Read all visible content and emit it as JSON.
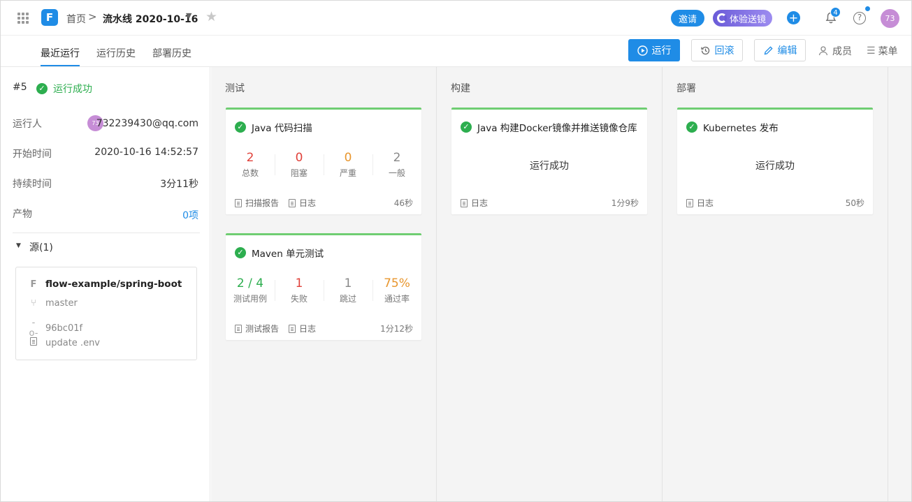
{
  "header": {
    "logo": "F",
    "breadcrumb_home": "首页",
    "breadcrumb_sep": ">",
    "pipeline_name": "流水线 2020-10-16",
    "invite_label": "邀请",
    "trial_label": "体验送镜",
    "notification_count": "4",
    "avatar_text": "73"
  },
  "tabs": [
    "最近运行",
    "运行历史",
    "部署历史"
  ],
  "toolbar": {
    "run_label": "运行",
    "rollback_label": "回滚",
    "edit_label": "编辑",
    "members_label": "成员",
    "menu_label": "菜单"
  },
  "sidebar": {
    "run_number": "#5",
    "run_status": "运行成功",
    "runner_label": "运行人",
    "runner_avatar": "73",
    "runner_value": "732239430@qq.com",
    "start_label": "开始时间",
    "start_value": "2020-10-16 14:52:57",
    "duration_label": "持续时间",
    "duration_value": "3分11秒",
    "artifact_label": "产物",
    "artifact_value": "0项",
    "source_header": "源(1)",
    "source": {
      "repo": "flow-example/spring-boot",
      "branch": "master",
      "commit": "96bc01f",
      "message": "update .env"
    }
  },
  "stages": [
    {
      "title": "测试",
      "jobs": [
        {
          "name": "Java 代码扫描",
          "metrics": [
            {
              "value": "2",
              "label": "总数",
              "color": "#e0413a"
            },
            {
              "value": "0",
              "label": "阻塞",
              "color": "#e0413a"
            },
            {
              "value": "0",
              "label": "严重",
              "color": "#e8962e"
            },
            {
              "value": "2",
              "label": "一般",
              "color": "#888888"
            }
          ],
          "report_label": "扫描报告",
          "log_label": "日志",
          "duration": "46秒"
        },
        {
          "name": "Maven 单元测试",
          "metrics": [
            {
              "value": "2 / 4",
              "label": "测试用例",
              "color": "#2dae4f"
            },
            {
              "value": "1",
              "label": "失败",
              "color": "#e0413a"
            },
            {
              "value": "1",
              "label": "跳过",
              "color": "#888888"
            },
            {
              "value": "75%",
              "label": "通过率",
              "color": "#e8962e"
            }
          ],
          "report_label": "测试报告",
          "log_label": "日志",
          "duration": "1分12秒"
        }
      ]
    },
    {
      "title": "构建",
      "jobs": [
        {
          "name": "Java 构建Docker镜像并推送镜像仓库",
          "status": "运行成功",
          "log_label": "日志",
          "duration": "1分9秒"
        }
      ]
    },
    {
      "title": "部署",
      "jobs": [
        {
          "name": "Kubernetes 发布",
          "status": "运行成功",
          "log_label": "日志",
          "duration": "50秒"
        }
      ]
    }
  ],
  "colors": {
    "accent": "#1f8ce6",
    "success": "#2dae4f",
    "card_top": "#6fcd72"
  }
}
